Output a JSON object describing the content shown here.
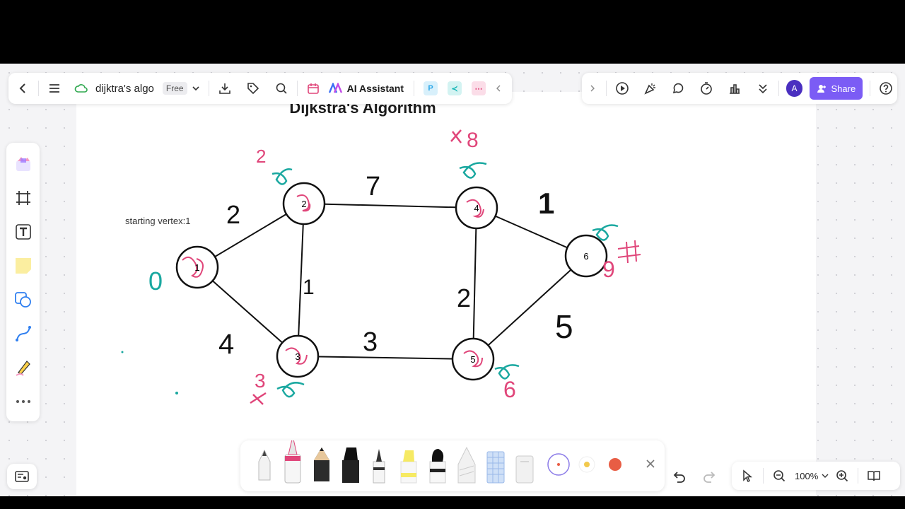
{
  "toolbar": {
    "doc_name": "dijktra's algo",
    "plan_badge": "Free",
    "ai_assistant_label": "AI Assistant",
    "apps": [
      {
        "name": "P",
        "color": "#2aa6e8"
      },
      {
        "name": "flow",
        "color": "#16b6b6"
      },
      {
        "name": "mind",
        "color": "#e0467a"
      }
    ]
  },
  "right_toolbar": {
    "avatar_initial": "A",
    "share_label": "Share"
  },
  "zoom": {
    "level": "100%"
  },
  "canvas": {
    "title": "Dijkstra's Algorithm",
    "note": "starting vertex:1",
    "nodes": [
      "1",
      "2",
      "3",
      "4",
      "5",
      "6"
    ],
    "edge_weights": {
      "e12": "2",
      "e13": "4",
      "e23": "1",
      "e24": "7",
      "e35": "3",
      "e45": "2",
      "e46": "1",
      "e56": "5"
    },
    "annotations": {
      "n1_dist": "0",
      "n2_dist": "2",
      "n3_dist": "3",
      "n4_dist": "8",
      "n6_dist": "9",
      "n5_dist": "6"
    }
  },
  "colors": {
    "accent": "#7b5cf5",
    "ink_pink": "#e0467a",
    "ink_teal": "#1aa8a0",
    "ink_black": "#111111"
  },
  "pen_tray": {
    "tools": [
      "pen",
      "fountain-pen",
      "pencil",
      "marker",
      "fineliner",
      "highlighter",
      "brush-marker",
      "crayon",
      "pattern-brush",
      "eraser"
    ],
    "colors": [
      "#ffffff",
      "#f2c94c",
      "#e85d44"
    ]
  }
}
